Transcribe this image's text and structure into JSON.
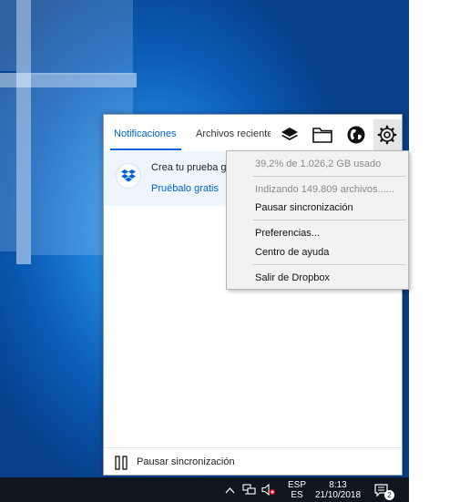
{
  "popup": {
    "tabs": [
      {
        "label": "Notificaciones",
        "active": true
      },
      {
        "label": "Archivos reciente",
        "active": false
      }
    ],
    "header_icons": [
      "layers-icon",
      "folder-icon",
      "globe-icon",
      "gear-icon"
    ],
    "notification": {
      "title": "Crea tu prueba gr",
      "link": "Pruébalo gratis"
    },
    "footer": {
      "pause_label": "Pausar sincronización"
    }
  },
  "menu": {
    "usage": "39,2% de 1.026,2 GB usado",
    "indexing": "Indizando 149.809 archivos......",
    "pause": "Pausar sincronización",
    "preferences": "Preferencias...",
    "help": "Centro de ayuda",
    "quit": "Salir de Dropbox"
  },
  "taskbar": {
    "lang_line1": "ESP",
    "lang_line2": "ES",
    "time": "8:13",
    "date": "21/10/2018",
    "notification_count": "2"
  },
  "colors": {
    "accent": "#0061d5",
    "taskbar": "#10161d",
    "menu_bg": "#f2f2f2"
  }
}
